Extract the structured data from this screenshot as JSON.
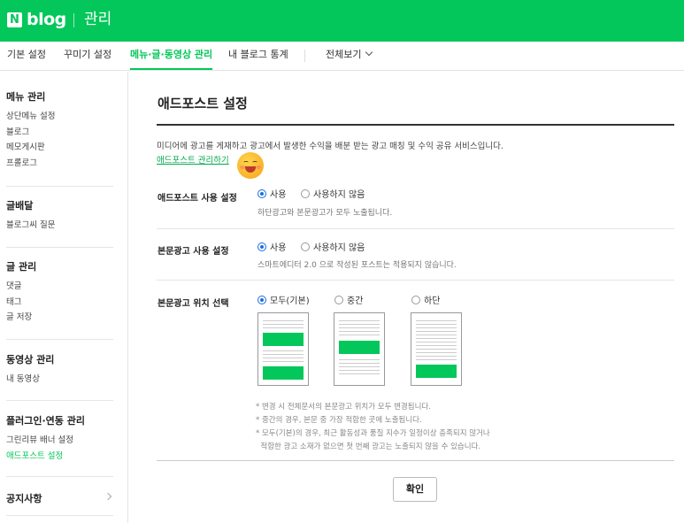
{
  "header": {
    "logo_mark": "N",
    "logo_text": "blog",
    "admin_label": "관리"
  },
  "topnav": {
    "tabs": [
      {
        "label": "기본 설정"
      },
      {
        "label": "꾸미기 설정"
      },
      {
        "label": "메뉴·글·동영상 관리"
      },
      {
        "label": "내 블로그 통계"
      },
      {
        "label": "전체보기"
      }
    ]
  },
  "sidebar": {
    "sections": [
      {
        "title": "메뉴 관리",
        "items": [
          "상단메뉴 설정",
          "블로그",
          "메모게시판",
          "프롤로그"
        ]
      },
      {
        "title": "글배달",
        "items": [
          "블로그씨 질문"
        ]
      },
      {
        "title": "글 관리",
        "items": [
          "댓글",
          "태그",
          "글 저장"
        ]
      },
      {
        "title": "동영상 관리",
        "items": [
          "내 동영상"
        ]
      },
      {
        "title": "플러그인·연동 관리",
        "items": [
          "그린리뷰 배너 설정",
          "애드포스트 설정"
        ]
      }
    ],
    "notice": "공지사항"
  },
  "main": {
    "title": "애드포스트 설정",
    "description": "미디어에 광고를 게재하고 광고에서 발생한 수익을 배분 받는 광고 매칭 및 수익 공유 서비스입니다.",
    "manage_link": "애드포스트 관리하기",
    "adpost_setting": {
      "label": "애드포스트 사용 설정",
      "option_on": "사용",
      "option_off": "사용하지 않음",
      "hint": "하단광고와 본문광고가 모두 노출됩니다."
    },
    "body_ad_setting": {
      "label": "본문광고 사용 설정",
      "option_on": "사용",
      "option_off": "사용하지 않음",
      "hint": "스마트에디터 2.0 으로 작성된 포스트는 적용되지 않습니다."
    },
    "position": {
      "label": "본문광고 위치 선택",
      "options": [
        "모두(기본)",
        "중간",
        "하단"
      ],
      "selected": "모두(기본)"
    },
    "notes": [
      "* 변경 시 전체문서의 본문광고 위치가 모두 변경됩니다.",
      "* 중간의 경우, 본문 중 가장 적합한 곳에 노출됩니다.",
      "* 모두(기본)의 경우, 최근 활동성과 품질 지수가 일정이상 충족되지 않거나",
      "  적합한 광고 소재가 없으면 첫 번째 광고는 노출되지 않을 수 있습니다."
    ],
    "confirm_label": "확인"
  },
  "colors": {
    "brand_green": "#03c75a",
    "radio_blue": "#1a6fe0"
  }
}
